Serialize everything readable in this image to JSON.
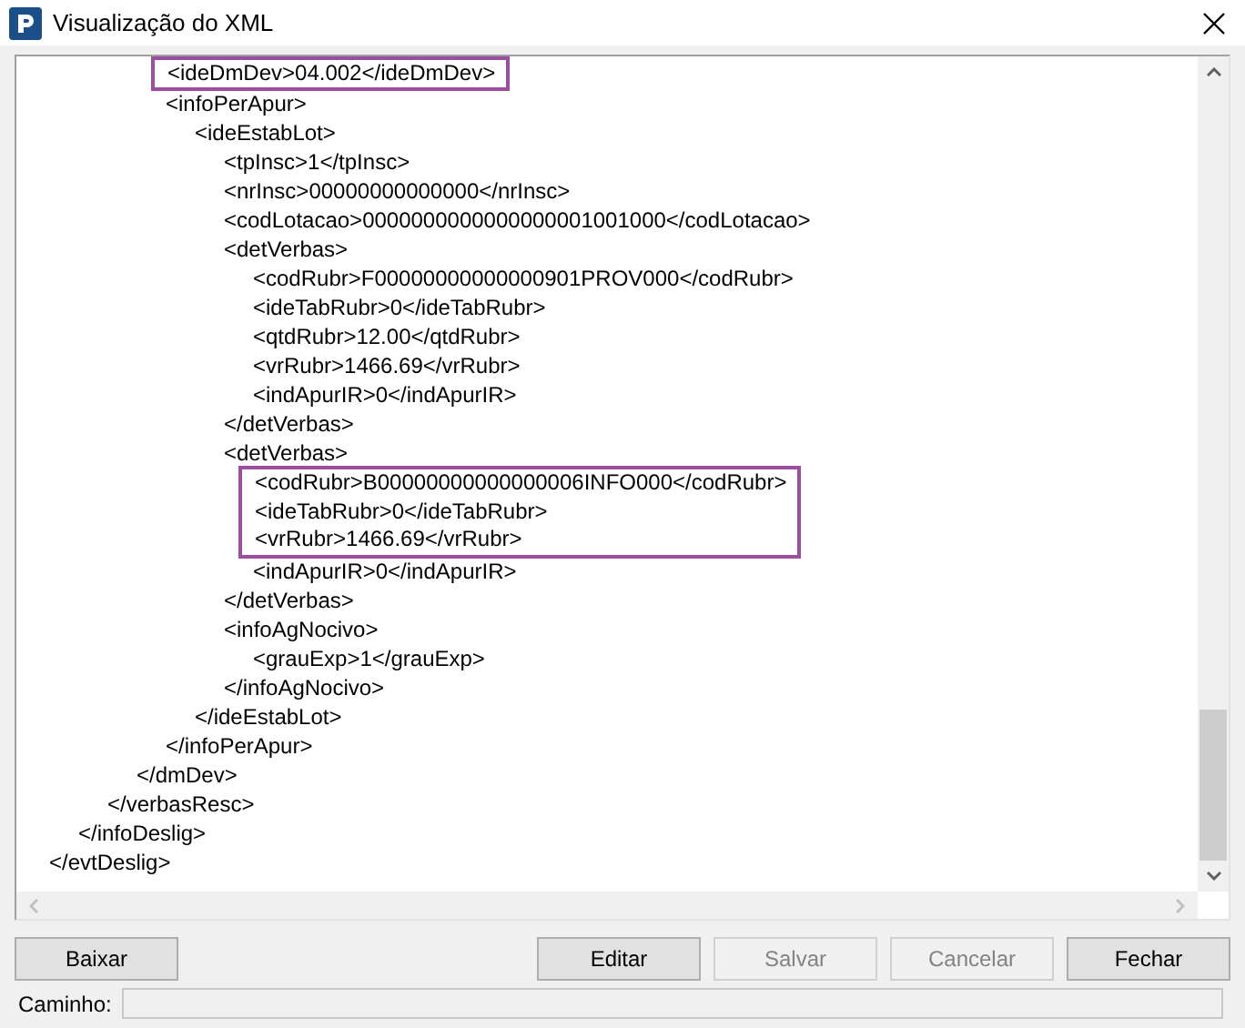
{
  "window": {
    "title": "Visualização do XML"
  },
  "xml_lines": [
    {
      "children": [
        {
          "children": [
            {
              "children": [
                {
                  "children": [
                    {
                      "text": "<ideDmDev>04.002</ideDmDev>",
                      "highlighted": true
                    },
                    {
                      "text": "<infoPerApur>",
                      "highlighted": false,
                      "children": [
                        {
                          "text": "<ideEstabLot>",
                          "highlighted": false,
                          "children": [
                            {
                              "text": "<tpInsc>1</tpInsc>",
                              "highlighted": false
                            },
                            {
                              "text": "<nrInsc>00000000000000</nrInsc>",
                              "highlighted": false
                            },
                            {
                              "text": "<codLotacao>0000000000000000001001000</codLotacao>",
                              "highlighted": false
                            },
                            {
                              "text": "<detVerbas>",
                              "highlighted": false,
                              "children": [
                                {
                                  "text": "<codRubr>F00000000000000901PROV000</codRubr>",
                                  "highlighted": false
                                },
                                {
                                  "text": "<ideTabRubr>0</ideTabRubr>",
                                  "highlighted": false
                                },
                                {
                                  "text": "<qtdRubr>12.00</qtdRubr>",
                                  "highlighted": false
                                },
                                {
                                  "text": "<vrRubr>1466.69</vrRubr>",
                                  "highlighted": false
                                },
                                {
                                  "text": "<indApurIR>0</indApurIR>",
                                  "highlighted": false
                                }
                              ]
                            },
                            {
                              "text": "</detVerbas>",
                              "highlighted": false
                            },
                            {
                              "text": "<detVerbas>",
                              "highlighted": false,
                              "children": [
                                {
                                  "text": "<codRubr>B00000000000000006INFO000</codRubr>",
                                  "highlighted": true
                                },
                                {
                                  "text": "<ideTabRubr>0</ideTabRubr>",
                                  "highlighted": true
                                },
                                {
                                  "text": "<vrRubr>1466.69</vrRubr>",
                                  "highlighted": true
                                },
                                {
                                  "text": "<indApurIR>0</indApurIR>",
                                  "highlighted": false
                                }
                              ]
                            },
                            {
                              "text": "</detVerbas>",
                              "highlighted": false
                            },
                            {
                              "text": "<infoAgNocivo>",
                              "highlighted": false,
                              "children": [
                                {
                                  "text": "<grauExp>1</grauExp>",
                                  "highlighted": false
                                }
                              ]
                            },
                            {
                              "text": "</infoAgNocivo>",
                              "highlighted": false
                            }
                          ]
                        },
                        {
                          "text": "</ideEstabLot>",
                          "highlighted": false
                        }
                      ]
                    },
                    {
                      "text": "</infoPerApur>",
                      "highlighted": false
                    }
                  ]
                },
                {
                  "text": "</dmDev>",
                  "highlighted": false
                }
              ]
            },
            {
              "text": "</verbasResc>",
              "highlighted": false
            }
          ]
        },
        {
          "text": "</infoDeslig>",
          "highlighted": false
        }
      ]
    },
    {
      "text": "</evtDeslig>",
      "highlighted": false
    }
  ],
  "buttons_left": [
    {
      "label": "Baixar",
      "disabled": false
    }
  ],
  "buttons_right": [
    {
      "label": "Editar",
      "disabled": false
    },
    {
      "label": "Salvar",
      "disabled": true
    },
    {
      "label": "Cancelar",
      "disabled": true
    },
    {
      "label": "Fechar",
      "disabled": false
    }
  ],
  "path": {
    "label": "Caminho:"
  }
}
